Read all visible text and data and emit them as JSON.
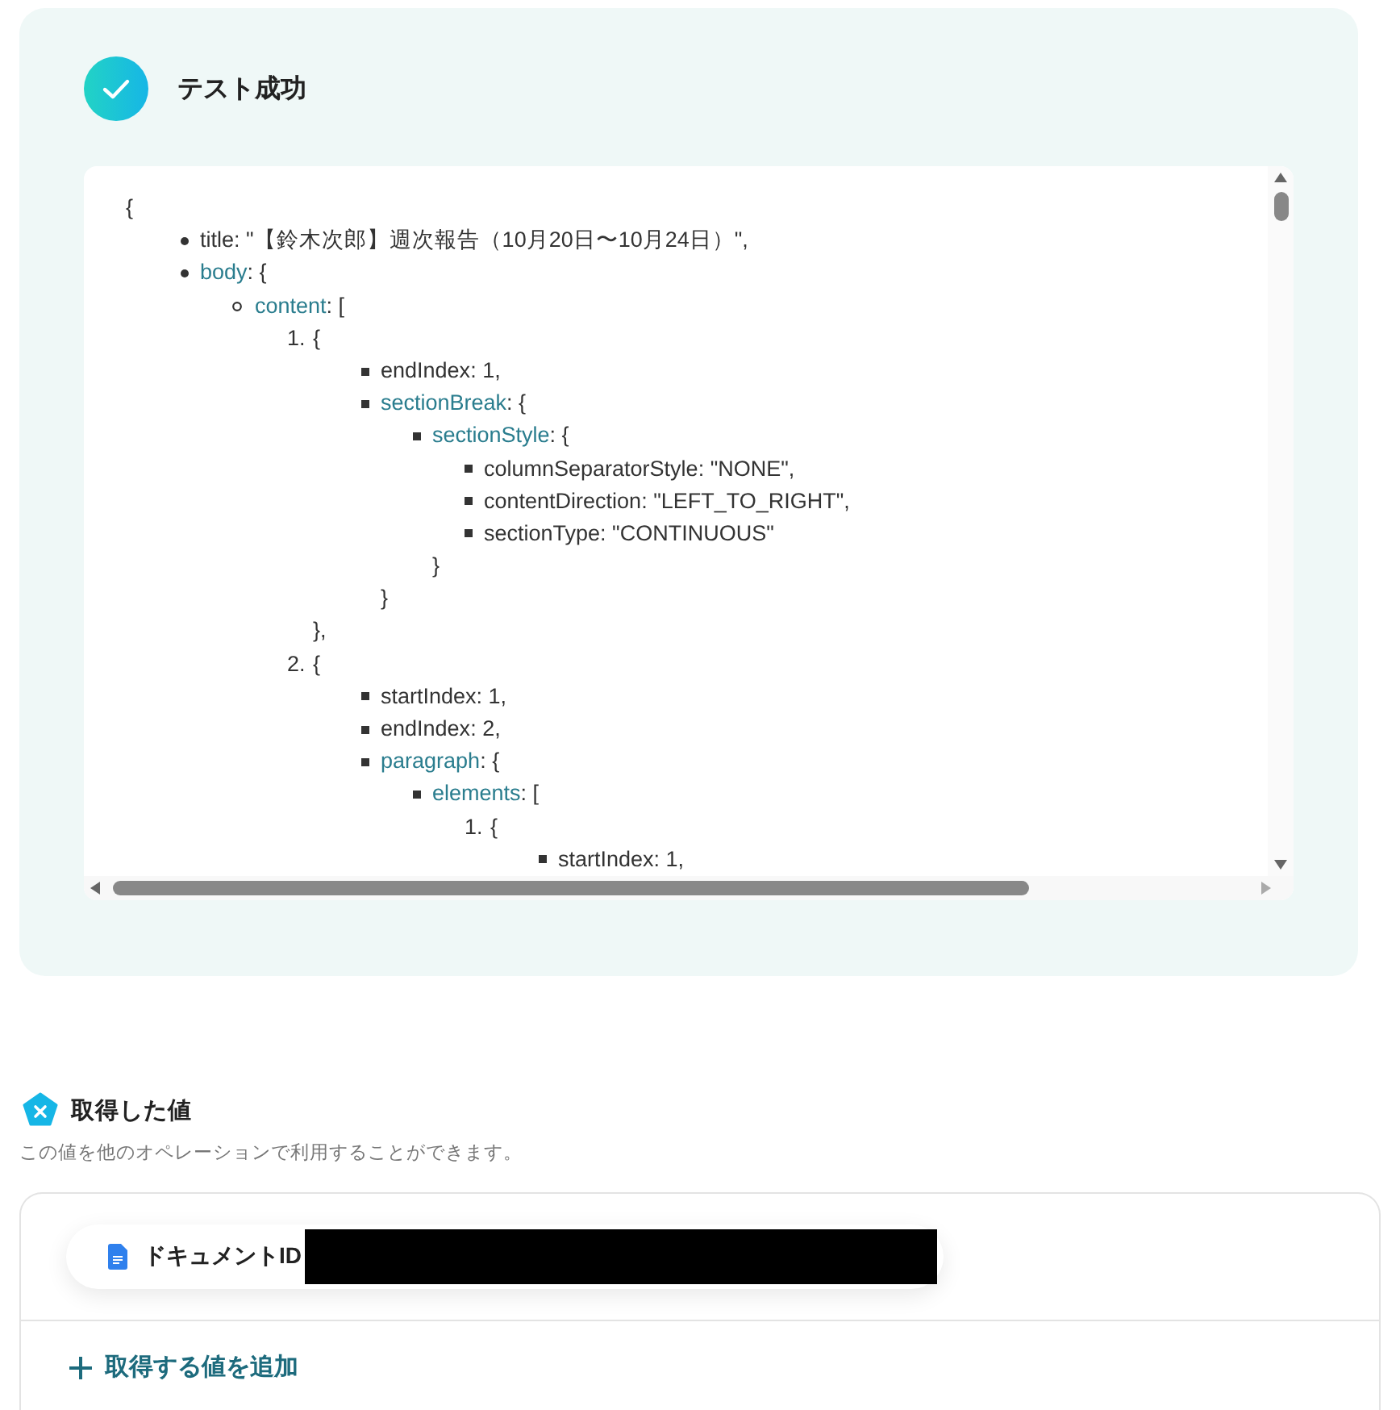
{
  "result": {
    "title": "テスト成功",
    "success": true
  },
  "output": {
    "open": "{",
    "items": [
      {
        "kind": "disc",
        "key": "title",
        "text": ": \"【鈴木次郎】週次報告（10月20日〜10月24日）\","
      },
      {
        "kind": "disc",
        "key": "body",
        "text": ": {",
        "children": [
          {
            "kind": "circle",
            "key": "content",
            "text": ": [",
            "children": [
              {
                "kind": "number",
                "number": "1.",
                "text": "{",
                "close": "},",
                "children": [
                  {
                    "kind": "square",
                    "key": "endIndex",
                    "text": ": 1,"
                  },
                  {
                    "kind": "square",
                    "key": "sectionBreak",
                    "text": ": {",
                    "close": "}",
                    "children": [
                      {
                        "kind": "square",
                        "key": "sectionStyle",
                        "text": ": {",
                        "close": "}",
                        "children": [
                          {
                            "kind": "square",
                            "key": "columnSeparatorStyle",
                            "text": ": \"NONE\","
                          },
                          {
                            "kind": "square",
                            "key": "contentDirection",
                            "text": ": \"LEFT_TO_RIGHT\","
                          },
                          {
                            "kind": "square",
                            "key": "sectionType",
                            "text": ": \"CONTINUOUS\""
                          }
                        ]
                      }
                    ]
                  }
                ]
              },
              {
                "kind": "number",
                "number": "2.",
                "text": "{",
                "children": [
                  {
                    "kind": "square",
                    "key": "startIndex",
                    "text": ": 1,"
                  },
                  {
                    "kind": "square",
                    "key": "endIndex",
                    "text": ": 2,"
                  },
                  {
                    "kind": "square",
                    "key": "paragraph",
                    "text": ": {",
                    "children": [
                      {
                        "kind": "square",
                        "key": "elements",
                        "text": ": [",
                        "children": [
                          {
                            "kind": "number",
                            "number": "1.",
                            "text": "{",
                            "children": [
                              {
                                "kind": "square",
                                "key": "startIndex",
                                "text": ": 1,"
                              }
                            ]
                          }
                        ]
                      }
                    ]
                  }
                ]
              }
            ]
          }
        ]
      }
    ]
  },
  "values_section": {
    "title": "取得した値",
    "description": "この値を他のオペレーションで利用することができます。",
    "fields": [
      {
        "label": "ドキュメントID",
        "redacted": true
      }
    ],
    "add_button": "取得する値を追加"
  }
}
